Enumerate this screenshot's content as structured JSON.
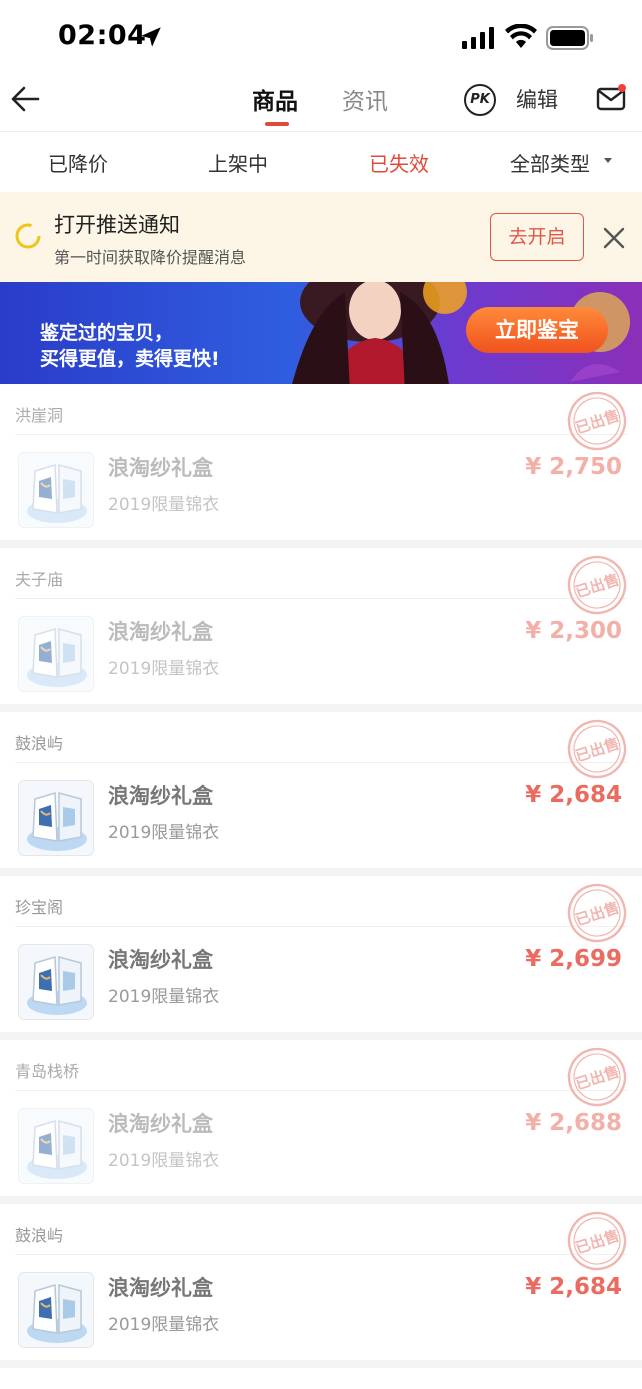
{
  "status_bar": {
    "time": "02:04"
  },
  "nav": {
    "tabs": [
      {
        "label": "商品"
      },
      {
        "label": "资讯"
      }
    ],
    "pk_label": "PK",
    "edit_label": "编辑"
  },
  "filters": [
    "已降价",
    "上架中",
    "已失效",
    "全部类型"
  ],
  "notice": {
    "title": "打开推送通知",
    "subtitle": "第一时间获取降价提醒消息",
    "button": "去开启"
  },
  "banner": {
    "line1": "鉴定过的宝贝，",
    "line2": "买得更值，卖得更快!",
    "button": "立即鉴宝"
  },
  "items": [
    {
      "store": "洪崖洞",
      "name": "浪淘纱礼盒",
      "subtitle": "2019限量锦衣",
      "price": "¥ 2,750",
      "stamp": "已出售",
      "faded": true
    },
    {
      "store": "夫子庙",
      "name": "浪淘纱礼盒",
      "subtitle": "2019限量锦衣",
      "price": "¥ 2,300",
      "stamp": "已出售",
      "faded": true
    },
    {
      "store": "鼓浪屿",
      "name": "浪淘纱礼盒",
      "subtitle": "2019限量锦衣",
      "price": "¥ 2,684",
      "stamp": "已出售",
      "faded": false
    },
    {
      "store": "珍宝阁",
      "name": "浪淘纱礼盒",
      "subtitle": "2019限量锦衣",
      "price": "¥ 2,699",
      "stamp": "已出售",
      "faded": false
    },
    {
      "store": "青岛栈桥",
      "name": "浪淘纱礼盒",
      "subtitle": "2019限量锦衣",
      "price": "¥ 2,688",
      "stamp": "已出售",
      "faded": true
    },
    {
      "store": "鼓浪屿",
      "name": "浪淘纱礼盒",
      "subtitle": "2019限量锦衣",
      "price": "¥ 2,684",
      "stamp": "已出售",
      "faded": false
    }
  ],
  "colors": {
    "accent": "#e04a3a",
    "notice_bg": "#fdf6e6",
    "banner": "#2f5ee0"
  }
}
